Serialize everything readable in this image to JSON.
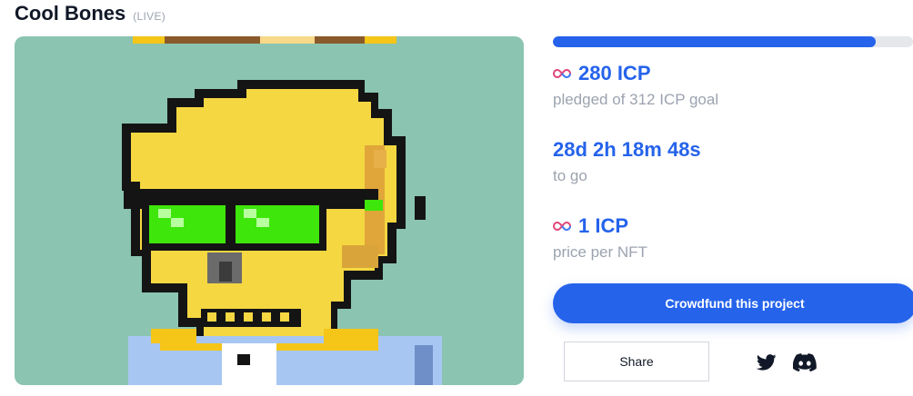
{
  "project": {
    "title": "Cool Bones",
    "status": "(LIVE)"
  },
  "artwork": {
    "icon": "pixel-skull-nft-image",
    "background_color": "#8bc4b0"
  },
  "funding": {
    "progress_fraction": 0.897,
    "pledged": "280 ICP",
    "pledged_label": "pledged of 312 ICP goal",
    "time_remaining": "28d 2h 18m 48s",
    "time_label": "to go",
    "price": "1 ICP",
    "price_label": "price per NFT"
  },
  "actions": {
    "crowdfund_label": "Crowdfund this project",
    "share_label": "Share"
  },
  "social": {
    "icons": [
      "twitter-icon",
      "discord-icon"
    ]
  },
  "colors": {
    "accent": "#2563eb",
    "muted_text": "#9ca3af",
    "progress_track": "#e5e7eb"
  }
}
